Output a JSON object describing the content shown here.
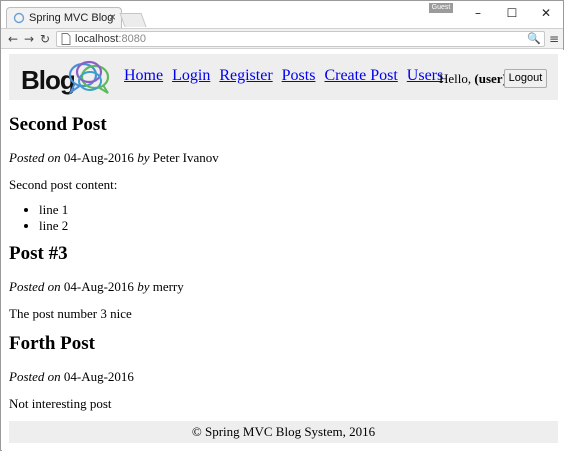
{
  "browser": {
    "tab_title": "Spring MVC Blog",
    "tab_close": "×",
    "profile_label": "Guest",
    "url_host": "localhost",
    "url_port": ":8080",
    "minimize": "–",
    "maximize": "☐",
    "close": "✕",
    "back": "←",
    "forward": "→",
    "reload": "↻",
    "zoom": "🔍",
    "menu": "≡"
  },
  "header": {
    "logo_text": "Blog",
    "nav": [
      "Home",
      "Login",
      "Register",
      "Posts",
      "Create Post",
      "Users"
    ],
    "hello_prefix": "Hello, ",
    "username": "(user)",
    "logout_label": "Logout"
  },
  "posts": [
    {
      "title": "Second Post",
      "posted_on_label": "Posted on",
      "date": "04-Aug-2016",
      "by_label": "by",
      "author": "Peter Ivanov",
      "content": "Second post content:",
      "list": [
        "line 1",
        "line 2"
      ]
    },
    {
      "title": "Post #3",
      "posted_on_label": "Posted on",
      "date": "04-Aug-2016",
      "by_label": "by",
      "author": "merry",
      "content": "The post number 3 nice"
    },
    {
      "title": "Forth Post",
      "posted_on_label": "Posted on",
      "date": "04-Aug-2016",
      "content": "Not interesting post"
    }
  ],
  "footer": {
    "text": "© Spring MVC Blog System, 2016"
  },
  "colors": {
    "header_bg": "#eeeeee",
    "link": "#0000ee",
    "footer_bg": "#eeeeee"
  }
}
